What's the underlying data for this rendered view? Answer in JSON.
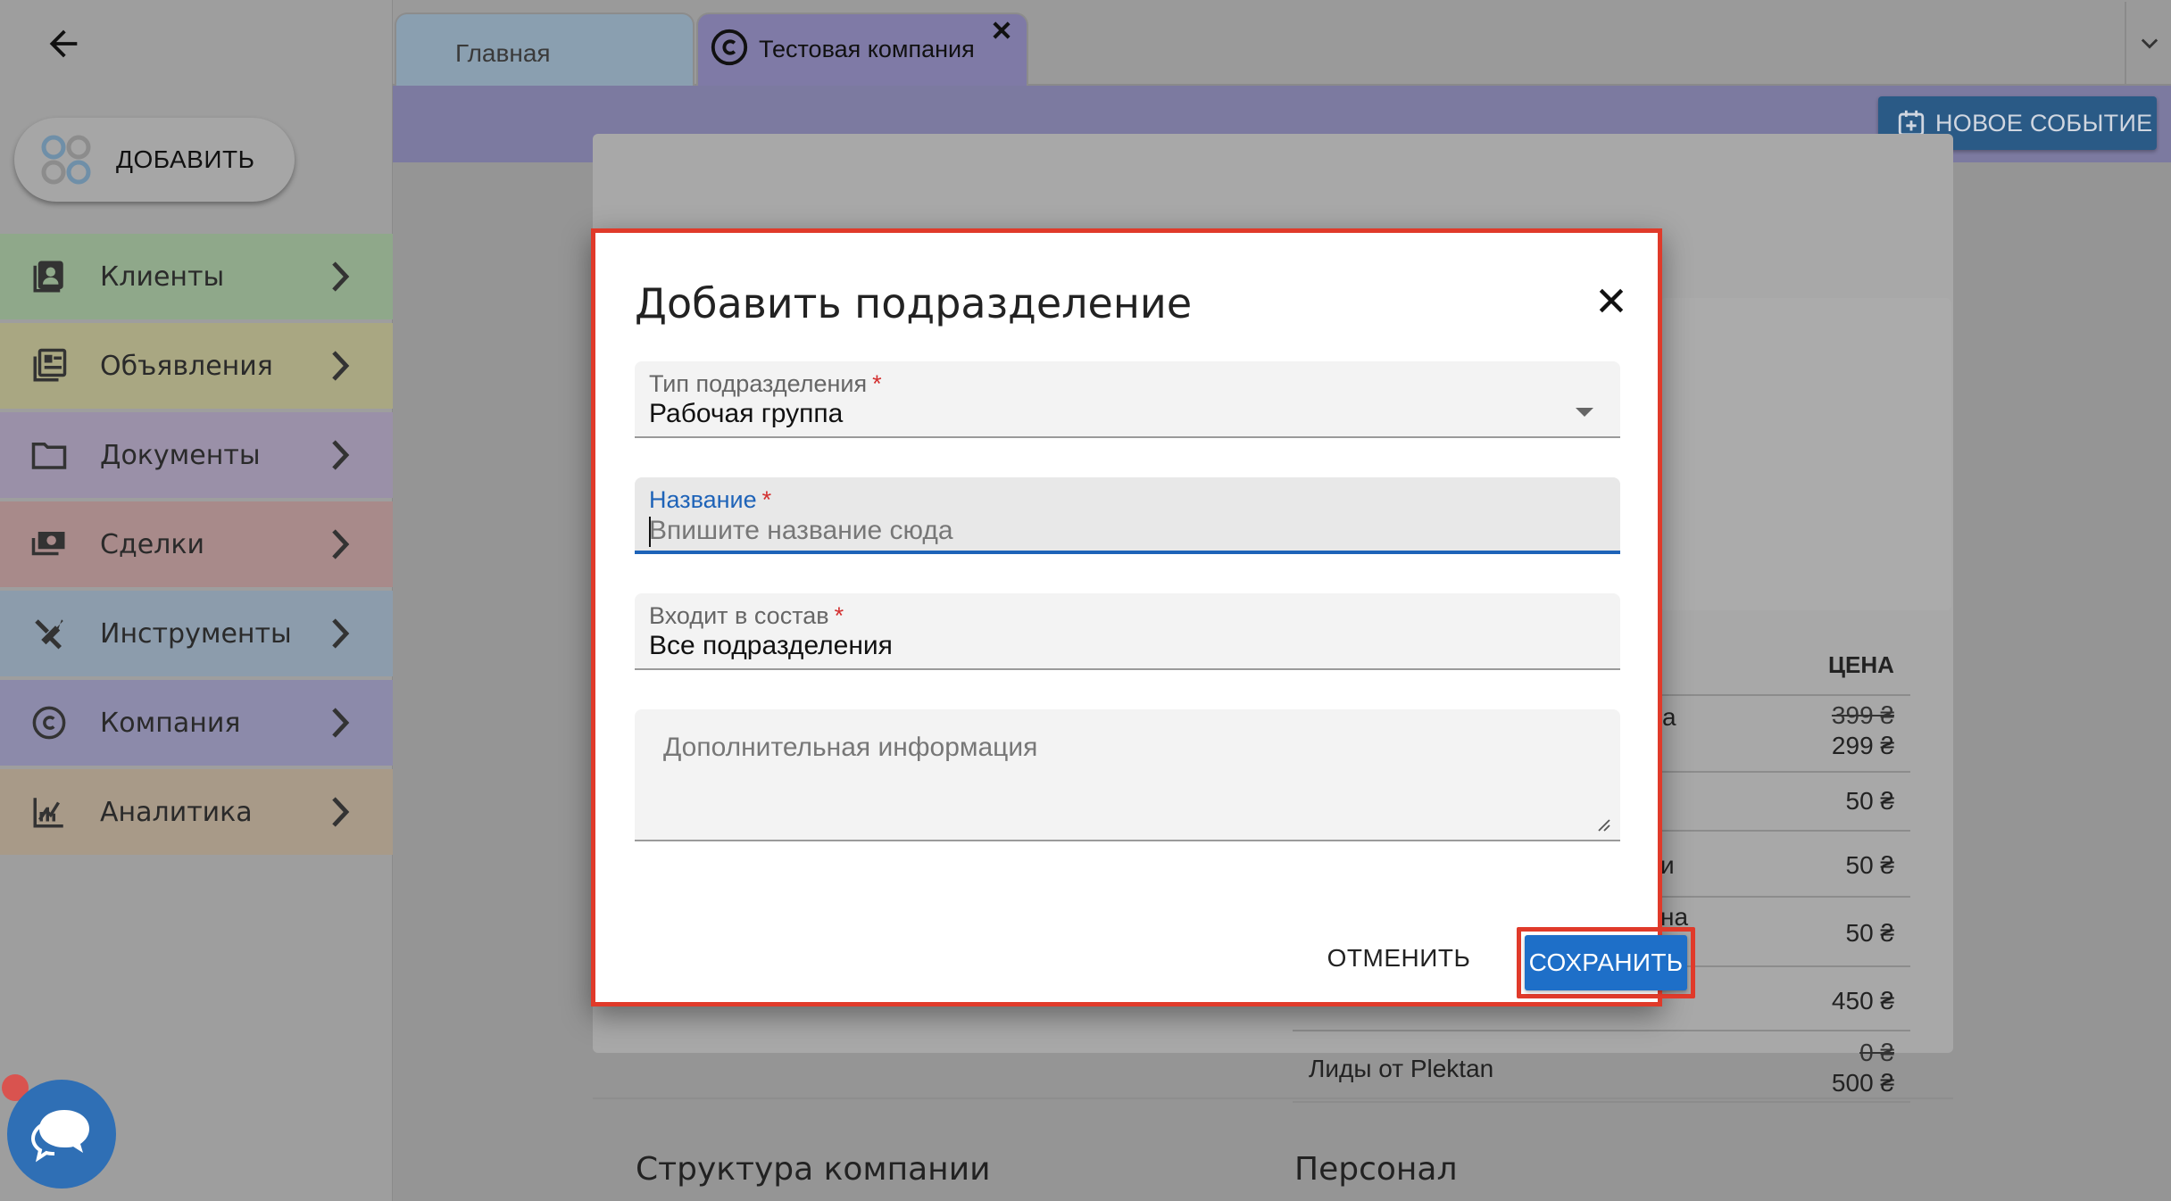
{
  "sidebar": {
    "add_label": "ДОБАВИТЬ",
    "items": [
      {
        "label": "Клиенты",
        "icon": "contacts-icon",
        "color": "#8fa88a"
      },
      {
        "label": "Объявления",
        "icon": "listings-icon",
        "color": "#a9a782"
      },
      {
        "label": "Документы",
        "icon": "folder-icon",
        "color": "#9a90a8"
      },
      {
        "label": "Сделки",
        "icon": "money-icon",
        "color": "#a88a8a"
      },
      {
        "label": "Инструменты",
        "icon": "tools-icon",
        "color": "#8c9cac"
      },
      {
        "label": "Компания",
        "icon": "copyright-icon",
        "color": "#8c8aaa"
      },
      {
        "label": "Аналитика",
        "icon": "analytics-icon",
        "color": "#a89a88"
      }
    ]
  },
  "tabs": {
    "home": "Главная",
    "company": "Тестовая компания"
  },
  "actions": {
    "new_event": "НОВОЕ СОБЫТИЕ"
  },
  "background": {
    "price_header": "ЦЕНА",
    "rows": [
      {
        "old": "399 ₴",
        "new": "299 ₴",
        "frag": "а"
      },
      {
        "old": "",
        "new": "50 ₴",
        "frag": ""
      },
      {
        "old": "",
        "new": "50 ₴",
        "frag": "и"
      },
      {
        "old": "",
        "new": "50 ₴",
        "frag": "на"
      },
      {
        "old": "",
        "new": "450 ₴",
        "frag": ""
      },
      {
        "old": "0 ₴",
        "new": "500 ₴",
        "frag": "Лиды от Plektan"
      }
    ],
    "section_structure": "Структура компании",
    "section_staff": "Персонал"
  },
  "dialog": {
    "title": "Добавить подразделение",
    "type_label": "Тип подразделения",
    "type_value": "Рабочая группа",
    "name_label": "Название",
    "name_placeholder": "Впишите название сюда",
    "parent_label": "Входит в состав",
    "parent_value": "Все подразделения",
    "info_placeholder": "Дополнительная информация",
    "required_mark": "*",
    "cancel": "ОТМЕНИТЬ",
    "save": "СОХРАНИТЬ"
  },
  "colors": {
    "accent": "#1e6fc8",
    "highlight": "#e03a2a",
    "action_bar": "#7c7aa0"
  }
}
